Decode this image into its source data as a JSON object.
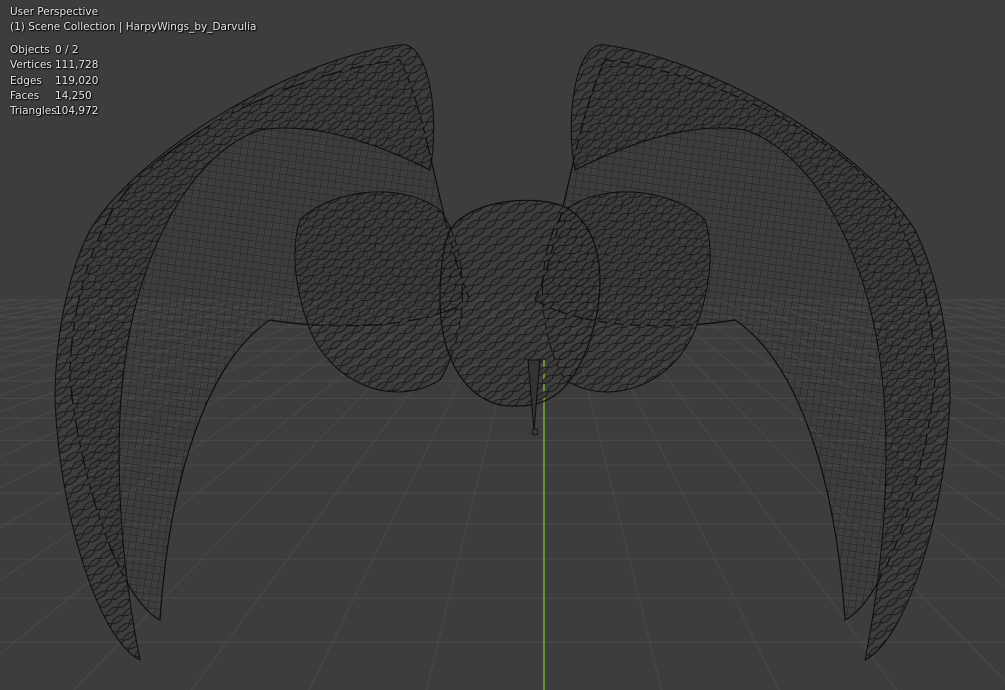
{
  "viewport": {
    "view_name": "User Perspective",
    "collection_label": "(1) Scene Collection | HarpyWings_by_Darvulia"
  },
  "stats": [
    {
      "label": "Objects",
      "value": "0 / 2"
    },
    {
      "label": "Vertices",
      "value": "111,728"
    },
    {
      "label": "Edges",
      "value": "119,020"
    },
    {
      "label": "Faces",
      "value": "14,250"
    },
    {
      "label": "Triangles",
      "value": "104,972"
    }
  ],
  "colors": {
    "background": "#3d3d3d",
    "grid": "#4a4a4a",
    "wireframe": "#111111",
    "y_axis": "#7fb03a"
  },
  "icons": {
    "model": "harpy-wings-wireframe"
  }
}
